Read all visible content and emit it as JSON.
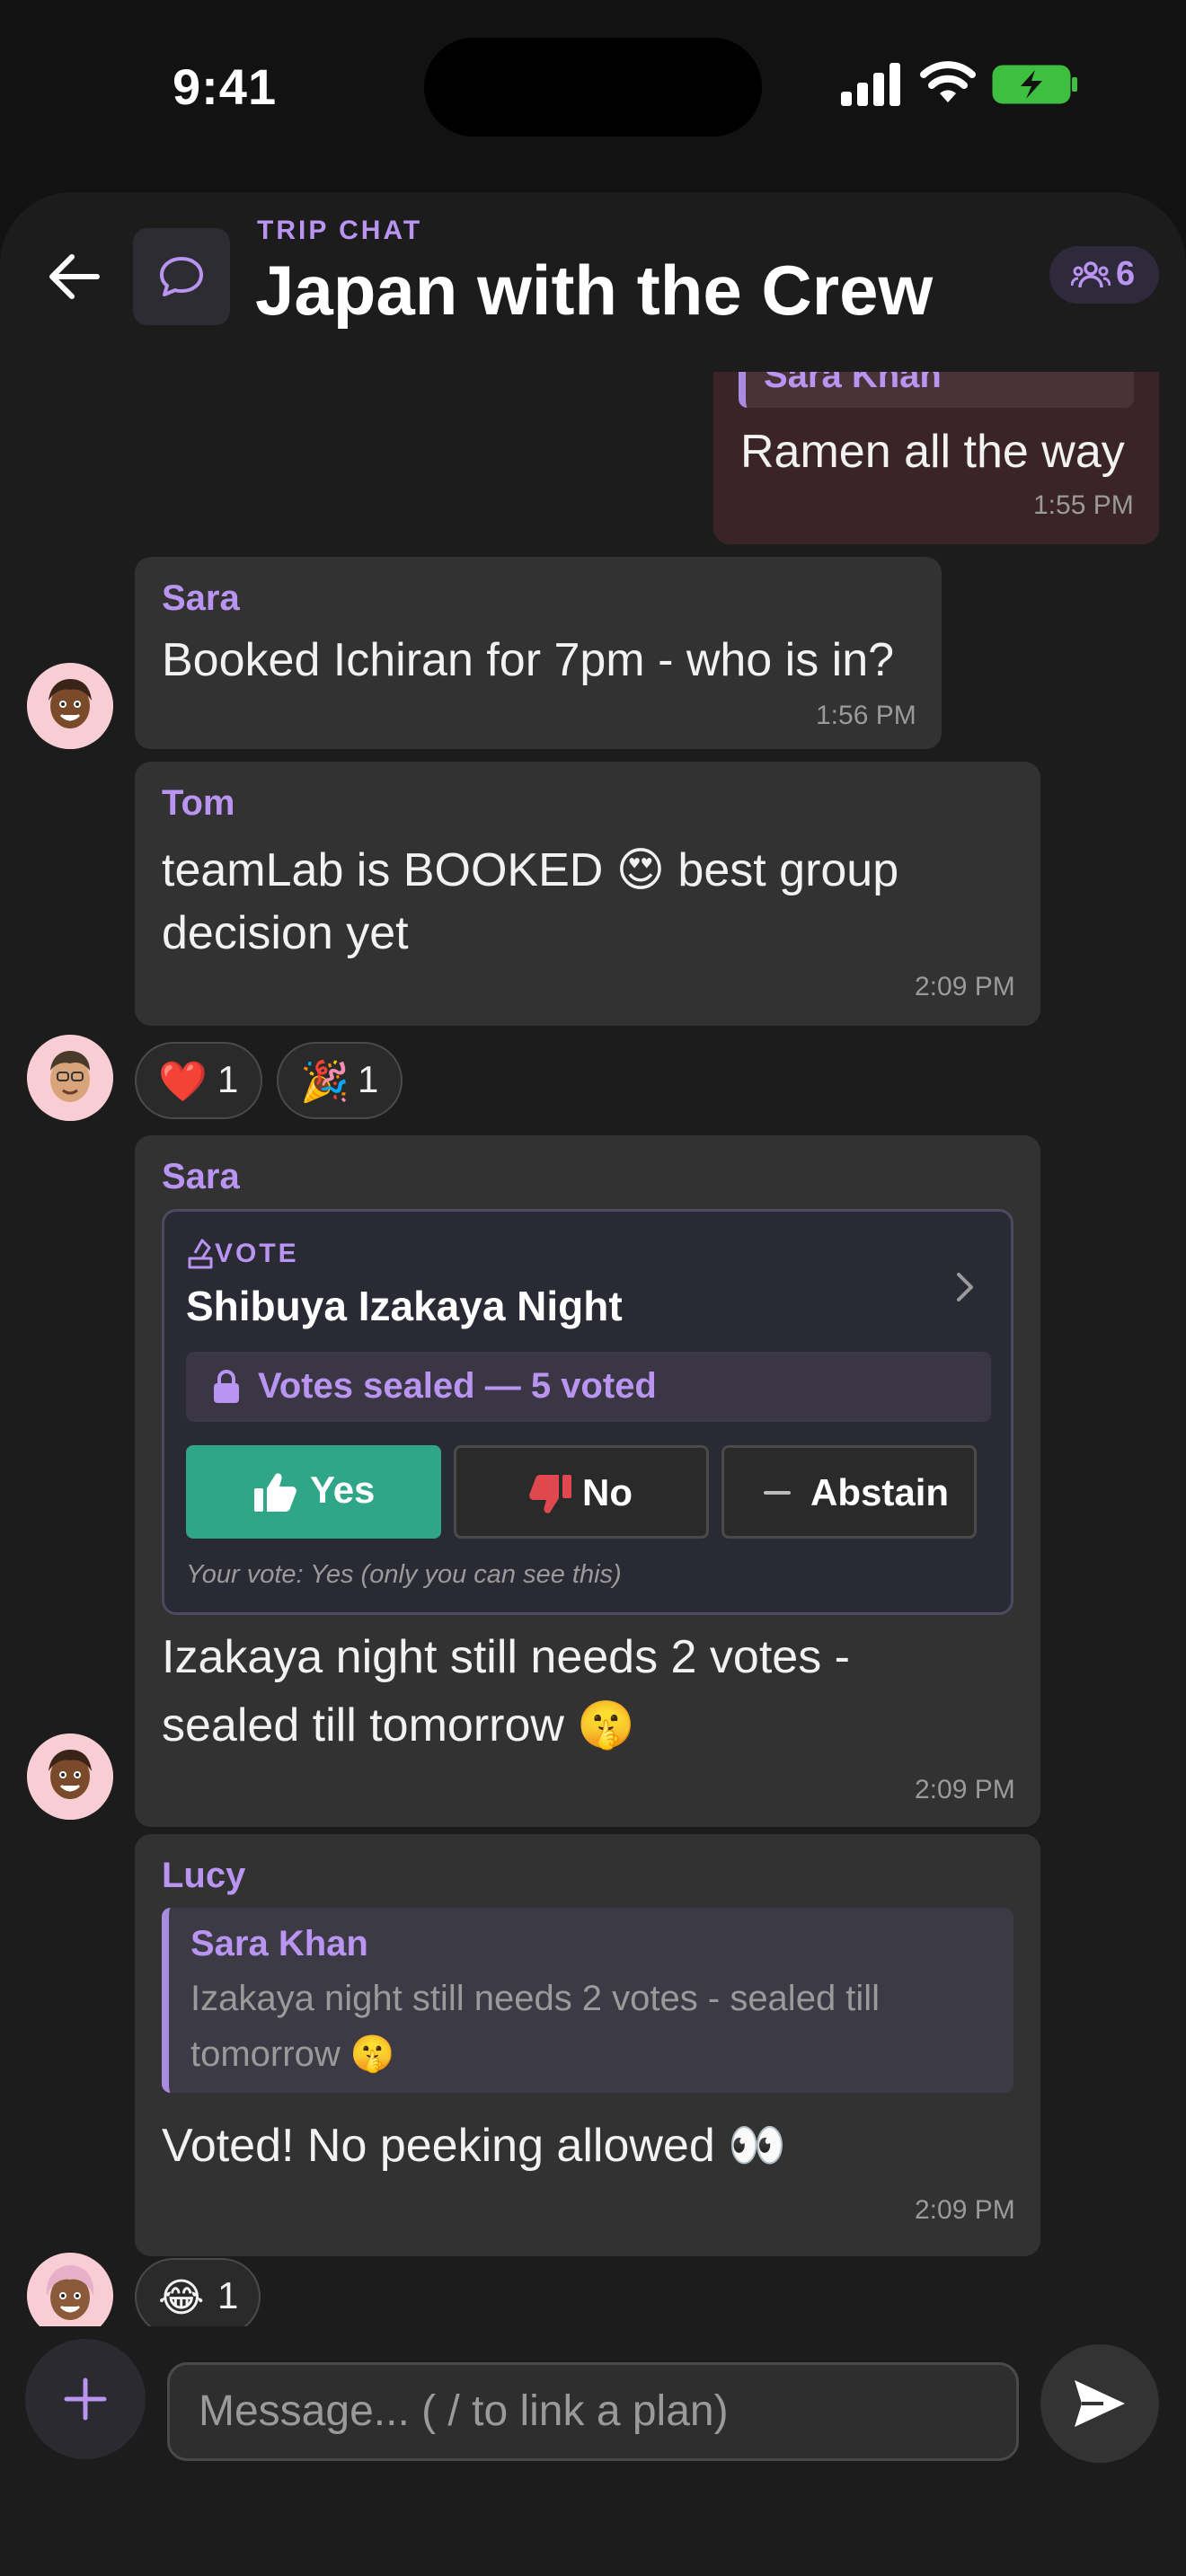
{
  "status_bar": {
    "time": "9:41"
  },
  "header": {
    "label": "TRIP CHAT",
    "title": "Japan with the Crew",
    "member_count": "6"
  },
  "messages": {
    "m1": {
      "quote_name": "Sara Khan",
      "text": "Ramen all the way",
      "time": "1:55 PM"
    },
    "m2": {
      "sender": "Sara",
      "text": "Booked Ichiran for 7pm - who is in?",
      "time": "1:56 PM"
    },
    "m3": {
      "sender": "Tom",
      "text_line1": "teamLab is BOOKED 😍 best group",
      "text_line2": "decision yet",
      "time": "2:09 PM",
      "reactions": [
        {
          "emoji": "❤️",
          "count": "1"
        },
        {
          "emoji": "🎉",
          "count": "1"
        }
      ]
    },
    "m4": {
      "sender": "Sara",
      "vote": {
        "tag": "VOTE",
        "title": "Shibuya Izakaya Night",
        "sealed": "Votes sealed — 5 voted",
        "yes": "Yes",
        "no": "No",
        "abstain": "Abstain",
        "your_vote": "Your vote: Yes (only you can see this)"
      },
      "text_line1": "Izakaya night still needs 2 votes -",
      "text_line2": "sealed till tomorrow 🤫",
      "time": "2:09 PM"
    },
    "m5": {
      "sender": "Lucy",
      "quote_name": "Sara Khan",
      "quote_line1": "Izakaya night still needs 2 votes - sealed till",
      "quote_line2": "tomorrow 🤫",
      "text": "Voted! No peeking allowed 👀",
      "time": "2:09 PM",
      "reactions": [
        {
          "emoji": "😂",
          "count": "1"
        }
      ]
    }
  },
  "composer": {
    "placeholder": "Message... ( / to link a plan)"
  },
  "colors": {
    "accent": "#b994f0",
    "yes_green": "#2fa688",
    "no_red": "#e0484f",
    "outgoing_bubble": "#3a2428"
  }
}
